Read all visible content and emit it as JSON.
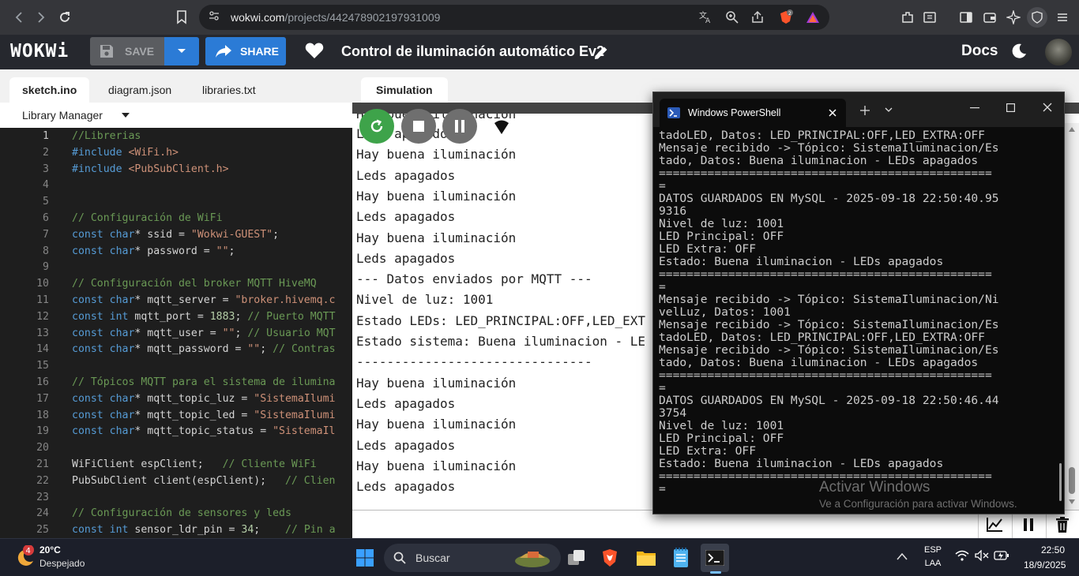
{
  "browser": {
    "url_host": "wokwi.com",
    "url_path": "/projects/442478902197931009"
  },
  "header": {
    "logo": "WOKWi",
    "save_label": "SAVE",
    "share_label": "SHARE",
    "project_title": "Control de iluminación automático Ev2",
    "docs_label": "Docs"
  },
  "editor": {
    "tabs": [
      "sketch.ino",
      "diagram.json",
      "libraries.txt"
    ],
    "library_manager": "Library Manager",
    "lines": [
      {
        "n": "1",
        "t": "//Librerias"
      },
      {
        "n": "2",
        "t": "#include <WiFi.h>"
      },
      {
        "n": "3",
        "t": "#include <PubSubClient.h>"
      },
      {
        "n": "4",
        "t": ""
      },
      {
        "n": "5",
        "t": ""
      },
      {
        "n": "6",
        "t": "// Configuración de WiFi"
      },
      {
        "n": "7",
        "t": "const char* ssid = \"Wokwi-GUEST\";"
      },
      {
        "n": "8",
        "t": "const char* password = \"\";"
      },
      {
        "n": "9",
        "t": ""
      },
      {
        "n": "10",
        "t": "// Configuración del broker MQTT HiveMQ"
      },
      {
        "n": "11",
        "t": "const char* mqtt_server = \"broker.hivemq.c"
      },
      {
        "n": "12",
        "t": "const int mqtt_port = 1883; // Puerto MQTT"
      },
      {
        "n": "13",
        "t": "const char* mqtt_user = \"\"; // Usuario MQT"
      },
      {
        "n": "14",
        "t": "const char* mqtt_password = \"\"; // Contras"
      },
      {
        "n": "15",
        "t": ""
      },
      {
        "n": "16",
        "t": "// Tópicos MQTT para el sistema de ilumina"
      },
      {
        "n": "17",
        "t": "const char* mqtt_topic_luz = \"SistemaIlumi"
      },
      {
        "n": "18",
        "t": "const char* mqtt_topic_led = \"SistemaIlumi"
      },
      {
        "n": "19",
        "t": "const char* mqtt_topic_status = \"SistemaIl"
      },
      {
        "n": "20",
        "t": ""
      },
      {
        "n": "21",
        "t": "WiFiClient espClient;   // Cliente WiFi"
      },
      {
        "n": "22",
        "t": "PubSubClient client(espClient);   // Clien"
      },
      {
        "n": "23",
        "t": ""
      },
      {
        "n": "24",
        "t": "// Configuración de sensores y leds"
      },
      {
        "n": "25",
        "t": "const int sensor_ldr_pin = 34;    // Pin a"
      }
    ]
  },
  "simulation": {
    "tab_label": "Simulation",
    "serial_lines": [
      "Leds apagados",
      "Hay buena iluminación",
      "Leds apagados",
      "Hay buena iluminación",
      "Leds apagados",
      "Hay buena iluminación",
      "Leds apagados",
      "--- Datos enviados por MQTT ---",
      "Nivel de luz: 1001",
      "Estado LEDs: LED_PRINCIPAL:OFF,LED_EXT",
      "Estado sistema: Buena iluminacion - LE",
      "-------------------------------",
      "Hay buena iluminación",
      "Leds apagados",
      "Hay buena iluminación",
      "Leds apagados",
      "Hay buena iluminación",
      "Leds apagados"
    ],
    "serial_top_fragment": "Hay buena iluminación"
  },
  "powershell": {
    "title": "Windows PowerShell",
    "lines": [
      "tadoLED, Datos: LED_PRINCIPAL:OFF,LED_EXTRA:OFF",
      "Mensaje recibido -> Tópico: SistemaIluminacion/Es",
      "tado, Datos: Buena iluminacion - LEDs apagados",
      "================================================",
      "=",
      "DATOS GUARDADOS EN MySQL - 2025-09-18 22:50:40.95",
      "9316",
      "Nivel de luz: 1001",
      "LED Principal: OFF",
      "LED Extra: OFF",
      "Estado: Buena iluminacion - LEDs apagados",
      "================================================",
      "=",
      "Mensaje recibido -> Tópico: SistemaIluminacion/Ni",
      "velLuz, Datos: 1001",
      "Mensaje recibido -> Tópico: SistemaIluminacion/Es",
      "tadoLED, Datos: LED_PRINCIPAL:OFF,LED_EXTRA:OFF",
      "Mensaje recibido -> Tópico: SistemaIluminacion/Es",
      "tado, Datos: Buena iluminacion - LEDs apagados",
      "================================================",
      "=",
      "DATOS GUARDADOS EN MySQL - 2025-09-18 22:50:46.44",
      "3754",
      "Nivel de luz: 1001",
      "LED Principal: OFF",
      "LED Extra: OFF",
      "Estado: Buena iluminacion - LEDs apagados",
      "================================================",
      "="
    ],
    "watermark_title": "Activar Windows",
    "watermark_sub": "Ve a Configuración para activar Windows."
  },
  "taskbar": {
    "weather_badge": "4",
    "temperature": "20°C",
    "weather": "Despejado",
    "search_placeholder": "Buscar",
    "lang": "ESP",
    "layout": "LAA",
    "time": "22:50",
    "date": "18/9/2025"
  },
  "colors": {
    "accent": "#2b7bd6",
    "run_green": "#3ea34a",
    "editor_bg": "#1e1e1e"
  }
}
